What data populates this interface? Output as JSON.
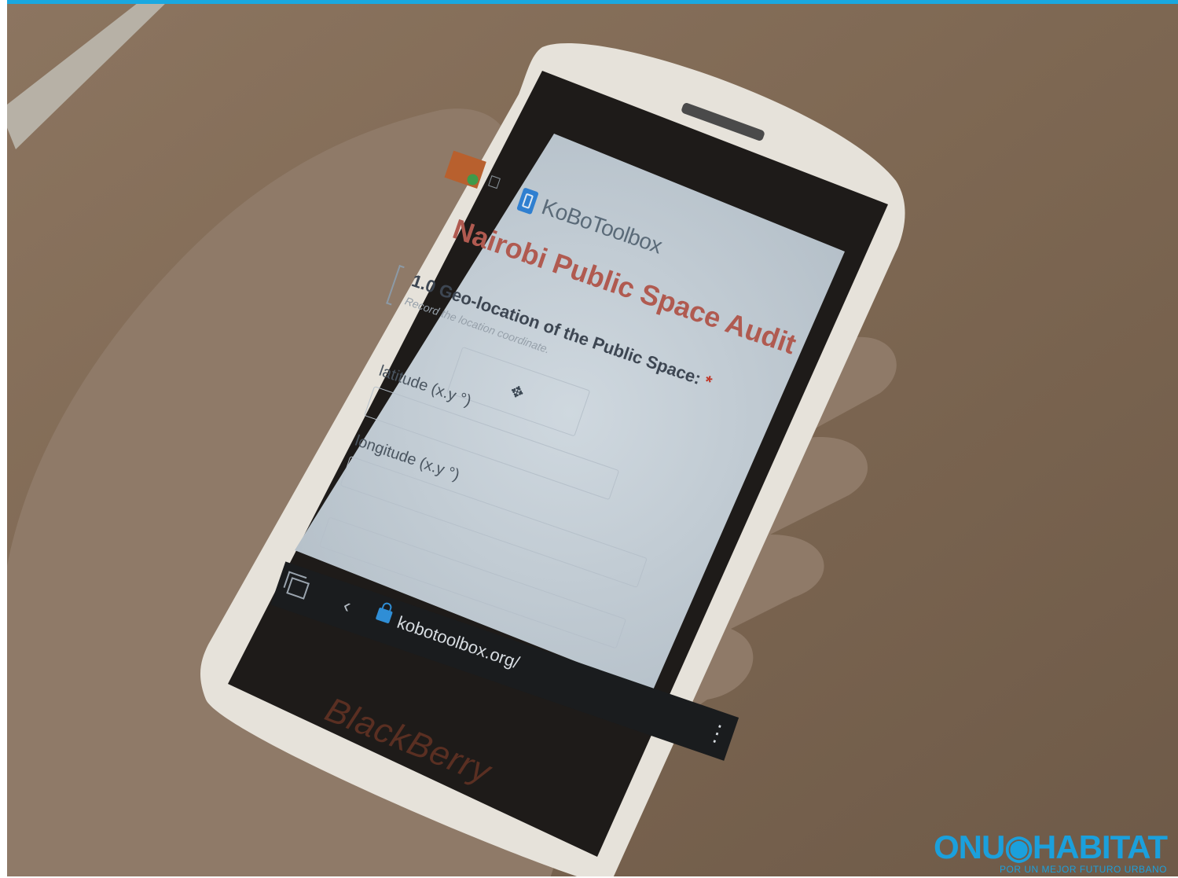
{
  "browser": {
    "app_name": "KoBoToolbox",
    "url": "kobotoolbox.org/ "
  },
  "form": {
    "title": "Nairobi Public Space Audit",
    "question_label": "1.0 Geo-location of the Public Space:",
    "required_marker": "*",
    "question_hint": "Record the location coordinate.",
    "latitude_label": "latitude (x.y °)",
    "longitude_label": "longitude (x.y °)"
  },
  "device": {
    "brand": "BlackBerry"
  },
  "watermark": {
    "main": "ONU◉HABITAT",
    "sub": "POR UN MEJOR FUTURO URBANO"
  },
  "colors": {
    "accent": "#1aa8e0",
    "title": "#b05a50",
    "lock": "#2f8ed6"
  }
}
